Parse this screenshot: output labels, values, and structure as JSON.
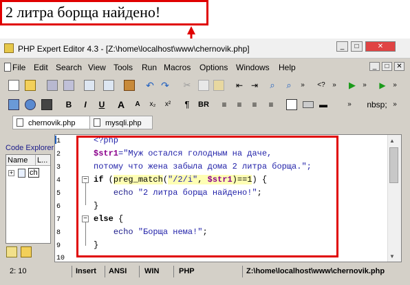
{
  "callout": {
    "text": "2 литра борща найдено!",
    "color": "#e00000"
  },
  "window": {
    "title": "PHP Expert Editor 4.3 - [Z:\\home\\localhost\\www\\chernovik.php]",
    "min": "_",
    "max": "□",
    "close": "✕",
    "doc_min": "_",
    "doc_max": "□",
    "doc_close": "✕"
  },
  "menu": [
    "File",
    "Edit",
    "Search",
    "View",
    "Tools",
    "Run",
    "Macros",
    "Options",
    "Windows",
    "Help"
  ],
  "toolbar": {
    "bold": "B",
    "italic": "I",
    "underline": "U",
    "font_big": "A",
    "font_small": "A",
    "subscript": "x₂",
    "superscript": "x²",
    "paragraph": "¶",
    "br": "BR",
    "nbsp": "nbsp;",
    "php_tag": "<?",
    "more": "»"
  },
  "tabs": [
    {
      "label": "chernovik.php",
      "active": true
    },
    {
      "label": "mysqli.php",
      "active": false
    }
  ],
  "explorer": {
    "title": "Code Explorer",
    "col_name": "Name",
    "col_l": "L...",
    "item": "ch"
  },
  "editor": {
    "line_numbers": [
      "1",
      "2",
      "3",
      "4",
      "5",
      "6",
      "7",
      "8",
      "9",
      "10"
    ],
    "highlight_color": "#fefeb4",
    "string_color": "#1f1fa8",
    "variable_color": "#8b008b"
  },
  "status": {
    "position": "2: 10",
    "mode": "Insert",
    "encoding": "ANSI",
    "line_endings": "WIN",
    "syntax": "PHP",
    "path": "Z:\\home\\localhost\\www\\chernovik.php"
  }
}
